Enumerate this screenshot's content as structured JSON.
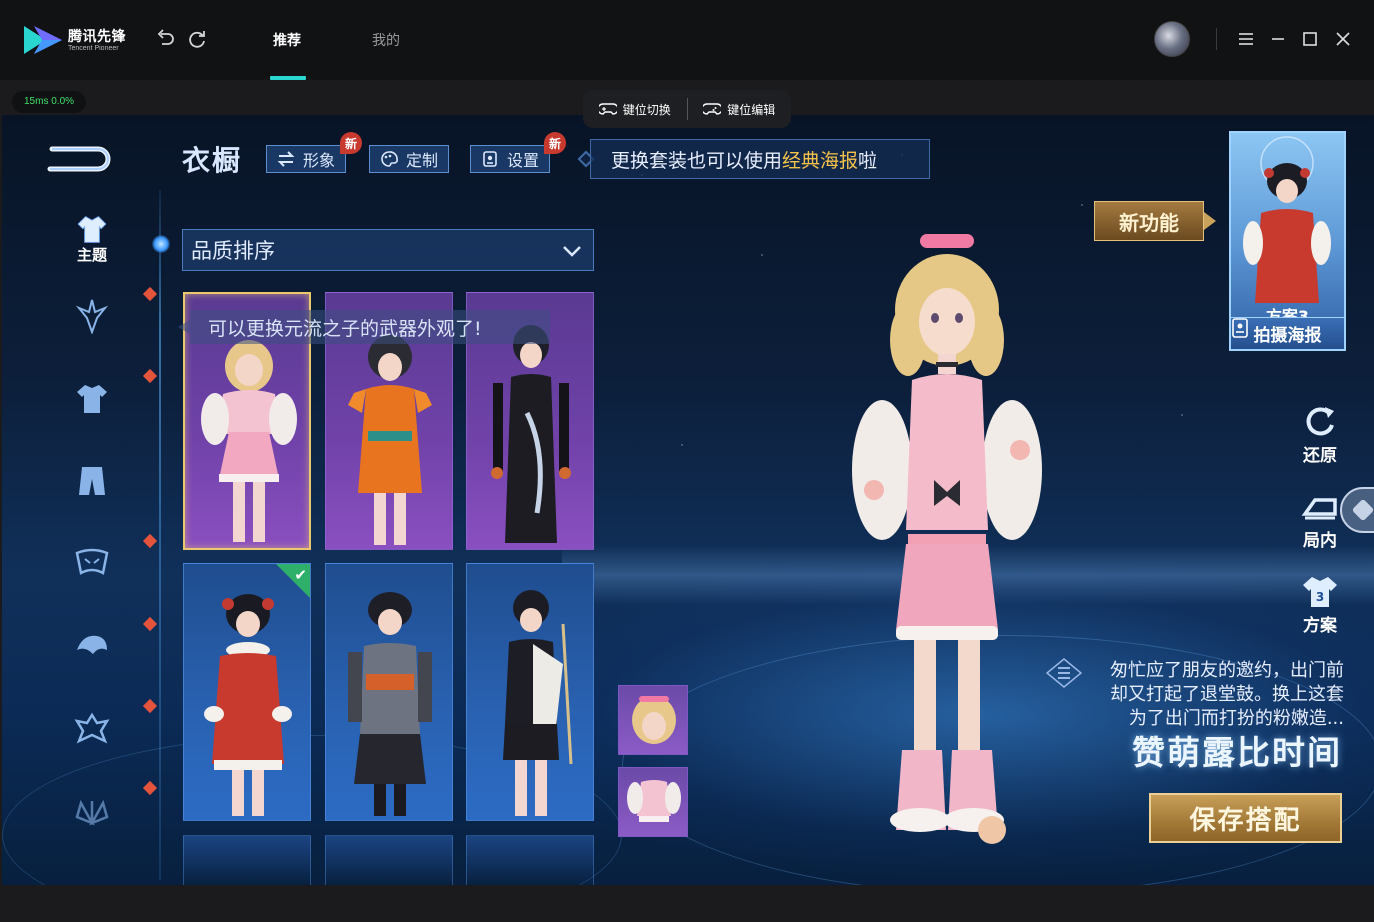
{
  "app": {
    "logo_cn": "腾讯先锋",
    "logo_en": "Tencent Pioneer",
    "tabs": [
      {
        "label": "推荐",
        "active": true
      },
      {
        "label": "我的",
        "active": false
      }
    ]
  },
  "status": {
    "ping": "15ms  0.0%"
  },
  "keymap": {
    "switch_label": "键位切换",
    "edit_label": "键位编辑"
  },
  "game": {
    "title": "衣橱",
    "header_buttons": [
      {
        "label": "形象",
        "badge": "新"
      },
      {
        "label": "定制",
        "badge": ""
      },
      {
        "label": "设置",
        "badge": "新"
      }
    ],
    "tip": {
      "prefix": "更换套装也可以使用",
      "highlight": "经典海报",
      "suffix": "啦"
    },
    "nav": {
      "active_label": "主题"
    },
    "sort": {
      "selected": "品质排序"
    },
    "weapon_tip": "可以更换元流之子的武器外观了!",
    "new_feature": "新功能",
    "plan": {
      "label": "方案3",
      "poster_button": "拍摄海报"
    },
    "side_actions": [
      {
        "label": "还原"
      },
      {
        "label": "局内"
      },
      {
        "label": "方案"
      }
    ],
    "lore": [
      "匆忙应了朋友的邀约，出门前",
      "却又打起了退堂鼓。换上这套",
      "为了出门而打扮的粉嫩造..."
    ],
    "outfit_name": "赞萌露比时间",
    "save_button": "保存搭配"
  },
  "colors": {
    "accent_tab": "#2ad6d0",
    "highlight": "#f5c24a",
    "gold": "#c79f58",
    "ping_green": "#3ee06a"
  }
}
